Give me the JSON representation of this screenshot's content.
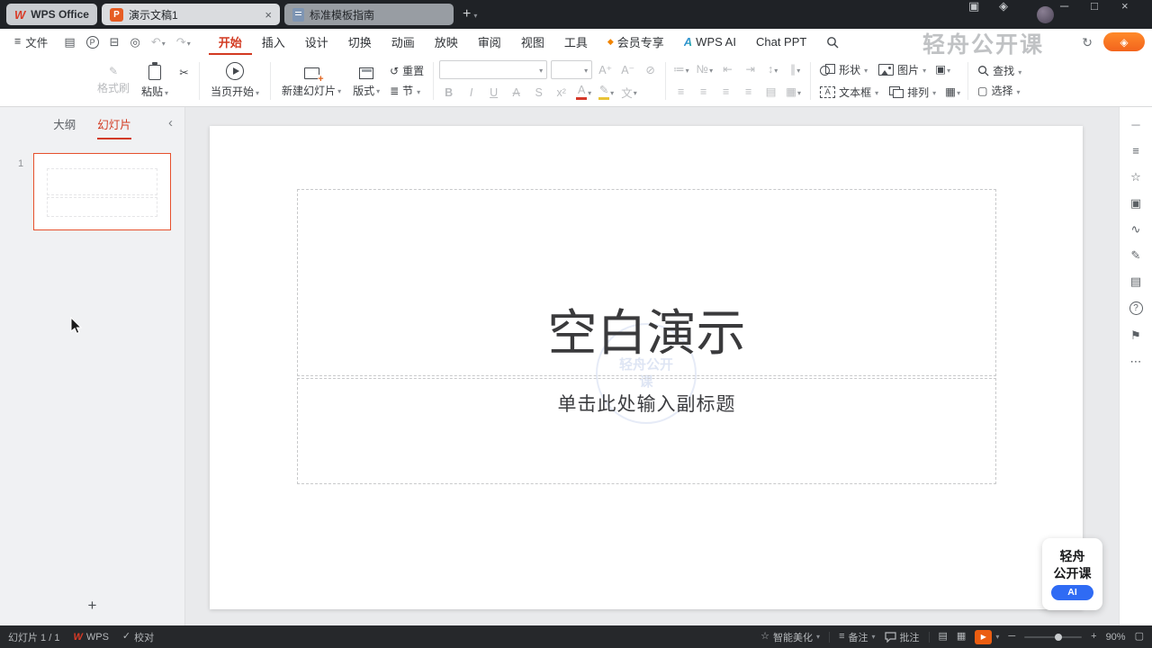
{
  "titlebar": {
    "home_label": "WPS Office",
    "doc_tab": "演示文稿1",
    "template_tab": "标准模板指南"
  },
  "menubar": {
    "file": "文件",
    "tabs": [
      "开始",
      "插入",
      "设计",
      "切换",
      "动画",
      "放映",
      "审阅",
      "视图",
      "工具",
      "会员专享",
      "WPS AI",
      "Chat PPT"
    ]
  },
  "watermark": "轻舟公开课",
  "ribbon": {
    "format_painter": "格式刷",
    "paste": "粘贴",
    "play_current": "当页开始",
    "new_slide": "新建幻灯片",
    "layout": "版式",
    "reset": "重置",
    "section": "节",
    "bold": "B",
    "italic": "I",
    "underline": "U",
    "strike": "A",
    "shadow": "S",
    "superscript": "x²",
    "font_color": "A",
    "effect": "文",
    "shapes": "形状",
    "pictures": "图片",
    "textbox": "文本框",
    "arrange": "排列",
    "find": "查找",
    "select": "选择"
  },
  "sidebar": {
    "outline_tab": "大纲",
    "slides_tab": "幻灯片",
    "slide_number": "1"
  },
  "slide": {
    "title": "空白演示",
    "subtitle": "单击此处输入副标题"
  },
  "statusbar": {
    "slide_info": "幻灯片 1 / 1",
    "wps": "WPS",
    "proofread": "校对",
    "beautify": "智能美化",
    "notes": "备注",
    "comment": "批注",
    "zoom": "90%"
  },
  "badge": {
    "line1": "轻舟",
    "line2": "公开课",
    "ai": "AI"
  },
  "colors": {
    "accent": "#d23a21",
    "tab_orange": "#e65c23",
    "play_orange": "#eb5d11",
    "ai_blue": "#2f6bf4"
  }
}
